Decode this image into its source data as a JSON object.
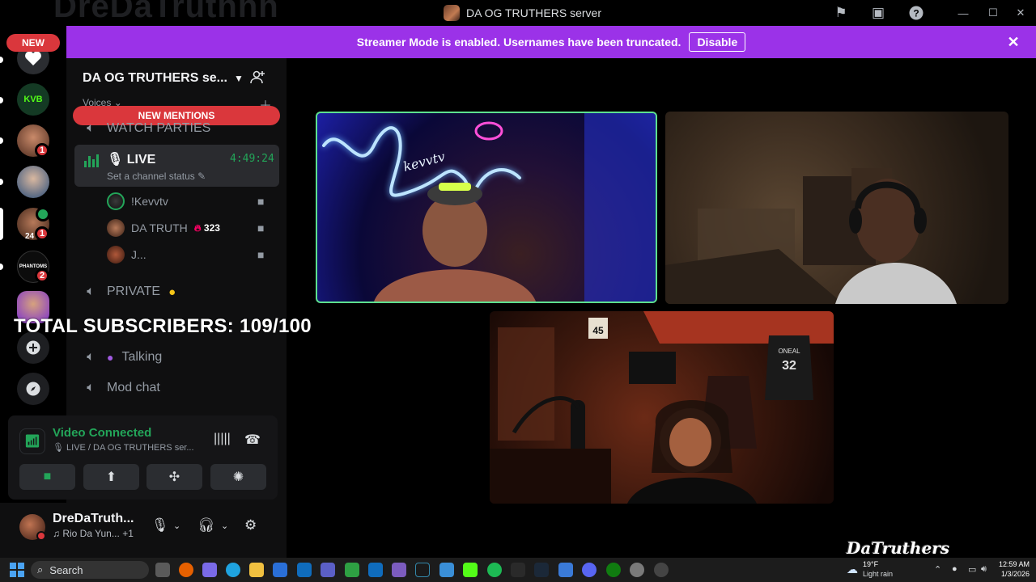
{
  "window": {
    "background_name": "DreDaTruthhh",
    "title": "DA OG TRUTHERS server"
  },
  "banner": {
    "message": "Streamer Mode is enabled. Usernames have been truncated.",
    "button": "Disable"
  },
  "rail": {
    "new_pill": "NEW",
    "badges": [
      "1",
      "24",
      "1",
      "2"
    ],
    "server_label_phantoms": "PHANTOMS"
  },
  "sidebar": {
    "server_name": "DA OG TRUTHERS se...",
    "category": "Voices",
    "new_mentions": "NEW MENTIONS",
    "channels": {
      "watch": "WATCH PARTIES",
      "live": "LIVE",
      "live_time": "4:49:24",
      "live_status": "Set a channel status",
      "private": "PRIVATE",
      "talking": "Talking",
      "modchat": "Mod chat"
    },
    "users": [
      {
        "name": "!Kevvtv"
      },
      {
        "name": "DA TRUTH",
        "badge": "323"
      },
      {
        "name": "J..."
      }
    ]
  },
  "overlay": {
    "subscribers": "TOTAL SUBSCRIBERS: 109/100"
  },
  "voice_panel": {
    "title": "Video Connected",
    "subtitle": "LIVE / DA OG TRUTHERS ser..."
  },
  "user_panel": {
    "name": "DreDaTruth...",
    "activity": "Rio Da Yun...",
    "activity_extra": "+1"
  },
  "videos": {
    "watermark": "DaTruthers",
    "sign_text": "kevvtv",
    "jersey_name": "ONEAL",
    "jersey_number": "32",
    "wall_number": "45"
  },
  "taskbar": {
    "search": "Search",
    "temp": "19°F",
    "condition": "Light rain",
    "time": "12:59 AM",
    "date": "1/3/2026"
  },
  "colors": {
    "accent_purple": "#9b32e8",
    "alert_red": "#da373c",
    "voice_green": "#23a559"
  }
}
